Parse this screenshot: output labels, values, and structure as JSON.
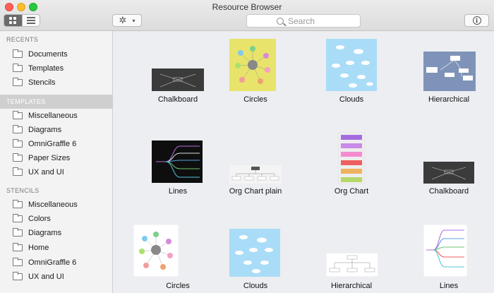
{
  "window": {
    "title": "Resource Browser"
  },
  "toolbar": {
    "view_icons_icon": "grid-view-icon",
    "view_list_icon": "list-view-icon",
    "gear_glyph": "✲",
    "chevron_glyph": "▾",
    "search_placeholder": "Search",
    "info_glyph": "i"
  },
  "sidebar": {
    "recents": {
      "header": "RECENTS",
      "items": [
        "Documents",
        "Templates",
        "Stencils"
      ]
    },
    "templates": {
      "header": "TEMPLATES",
      "items": [
        "Miscellaneous",
        "Diagrams",
        "OmniGraffle 6",
        "Paper Sizes",
        "UX and UI"
      ]
    },
    "stencils": {
      "header": "STENCILS",
      "items": [
        "Miscellaneous",
        "Colors",
        "Diagrams",
        "Home",
        "OmniGraffle 6",
        "UX and UI"
      ]
    }
  },
  "templates": [
    {
      "label": "Chalkboard"
    },
    {
      "label": "Circles"
    },
    {
      "label": "Clouds"
    },
    {
      "label": "Hierarchical"
    },
    {
      "label": "Lines"
    },
    {
      "label": "Org Chart plain"
    },
    {
      "label": "Org Chart"
    },
    {
      "label": "Chalkboard"
    },
    {
      "label": "Circles"
    },
    {
      "label": "Clouds"
    },
    {
      "label": "Hierarchical"
    },
    {
      "label": "Lines"
    }
  ],
  "colors": {
    "chalk_bg": "#3b3b3b",
    "circles_bg": "#e8e36a",
    "clouds_bg": "#a9dcf7",
    "hier_bg": "#7f93b8",
    "lines_bg": "#0e0e0e"
  }
}
